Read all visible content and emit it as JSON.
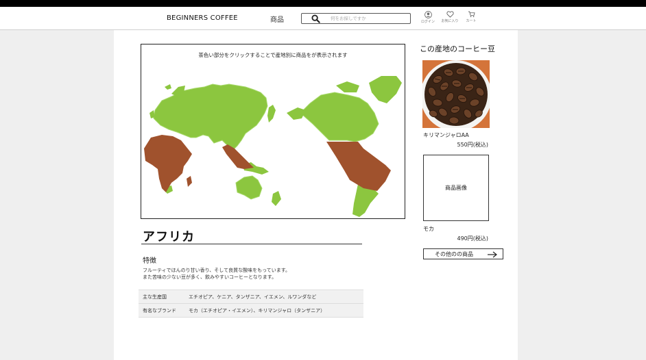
{
  "header": {
    "brand": "BEGINNERS COFFEE",
    "nav_products": "商品",
    "search_placeholder": "何をお探しですか",
    "icons": [
      {
        "name": "user-icon",
        "label": "ログイン"
      },
      {
        "name": "heart-icon",
        "label": "お気に入り"
      },
      {
        "name": "cart-icon",
        "label": "カート"
      }
    ]
  },
  "map": {
    "caption": "茶色い部分をクリックすることで産地別に商品をが表示されます",
    "colors": {
      "land": "#8cc63f",
      "region": "#a0522d"
    }
  },
  "region": {
    "title": "アフリカ",
    "feature_heading": "特徴",
    "feature_lines": [
      "フルーティでほんのり甘い香り、そして良質な酸味をもっています。",
      "また苦味の少ない豆が多く、飲みやすいコーヒーとなります。"
    ],
    "table": [
      {
        "label": "主な生産国",
        "value": "エチオピア、ケニア、タンザニア、イエメン、ルワンダなど"
      },
      {
        "label": "有名なブランド",
        "value": "モカ（エチオピア・イエメン）、キリマンジャロ（タンザニア）"
      }
    ]
  },
  "sidebar": {
    "title": "この産地のコーヒー豆",
    "products": [
      {
        "name": "キリマンジャロAA",
        "price": "550円(税込)"
      },
      {
        "name": "モカ",
        "price": "490円(税込)",
        "image_placeholder": "商品画像"
      }
    ],
    "more_button": "その他のの商品"
  }
}
